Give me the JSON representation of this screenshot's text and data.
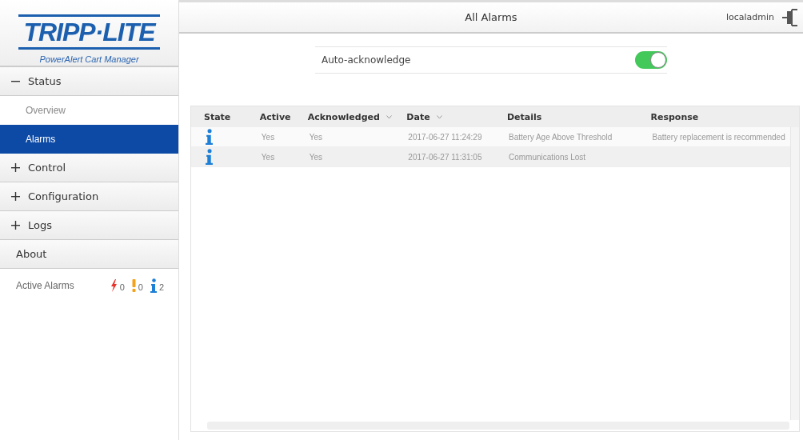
{
  "brand": {
    "logo": "TRIPP·LITE",
    "product": "PowerAlert Cart Manager"
  },
  "nav": [
    {
      "label": "Status",
      "expandable": true,
      "expanded": true,
      "children": [
        {
          "label": "Overview",
          "selected": false
        },
        {
          "label": "Alarms",
          "selected": true
        }
      ]
    },
    {
      "label": "Control",
      "expandable": true,
      "expanded": false
    },
    {
      "label": "Configuration",
      "expandable": true,
      "expanded": false
    },
    {
      "label": "Logs",
      "expandable": true,
      "expanded": false
    },
    {
      "label": "About",
      "expandable": false
    }
  ],
  "active_alarms": {
    "label": "Active Alarms",
    "counts": [
      {
        "kind": "critical",
        "count": "0"
      },
      {
        "kind": "warning",
        "count": "0"
      },
      {
        "kind": "info",
        "count": "2"
      }
    ]
  },
  "header": {
    "title": "All Alarms",
    "user": "localadmin"
  },
  "auto_acknowledge": {
    "label": "Auto-acknowledge",
    "on": true
  },
  "table": {
    "columns": [
      {
        "label": "State",
        "sortable": false
      },
      {
        "label": "Active",
        "sortable": false
      },
      {
        "label": "Acknowledged",
        "sortable": true
      },
      {
        "label": "Date",
        "sortable": true
      },
      {
        "label": "Details",
        "sortable": false
      },
      {
        "label": "Response",
        "sortable": false
      }
    ],
    "rows": [
      {
        "kind": "info",
        "active": "Yes",
        "acknowledged": "Yes",
        "date": "2017-06-27 11:24:29",
        "details": "Battery Age Above Threshold",
        "response": "Battery replacement is recommended"
      },
      {
        "kind": "info",
        "active": "Yes",
        "acknowledged": "Yes",
        "date": "2017-06-27 11:31:05",
        "details": "Communications Lost"
      }
    ]
  }
}
